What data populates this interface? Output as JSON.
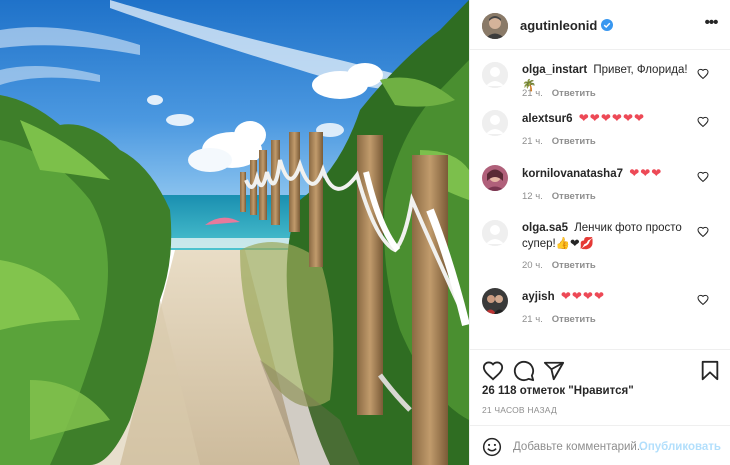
{
  "post": {
    "image_alt": "Beach path with rope fence",
    "author": {
      "username": "agutinleonid",
      "verified": true
    }
  },
  "comments": [
    {
      "username": "olga_instart",
      "text": "Привет, Флорида!🌴",
      "time": "21 ч.",
      "reply": "Ответить"
    },
    {
      "username": "alextsur6",
      "text": "❤❤❤❤❤❤",
      "time": "21 ч.",
      "reply": "Ответить"
    },
    {
      "username": "kornilovanatasha7",
      "text": "❤❤❤",
      "time": "12 ч.",
      "reply": "Ответить"
    },
    {
      "username": "olga.sa5",
      "text": "Ленчик фото просто супер!👍❤💋",
      "time": "20 ч.",
      "reply": "Ответить"
    },
    {
      "username": "ayjish",
      "text": "❤❤❤❤",
      "time": "21 ч.",
      "reply": "Ответить"
    }
  ],
  "actions": {
    "like_icon": "heart-icon",
    "comment_icon": "comment-icon",
    "share_icon": "send-icon",
    "save_icon": "bookmark-icon"
  },
  "likes_text": "26 118 отметок \"Нравится\"",
  "posted_ago": "21 ЧАСОВ НАЗАД",
  "add_comment": {
    "placeholder": "Добавьте комментарий...",
    "publish_label": "Опубликовать"
  },
  "colors": {
    "heart": "#ed4956",
    "verified": "#3897f0",
    "publish_disabled": "#b2dffc",
    "meta": "#8e8e8e"
  }
}
